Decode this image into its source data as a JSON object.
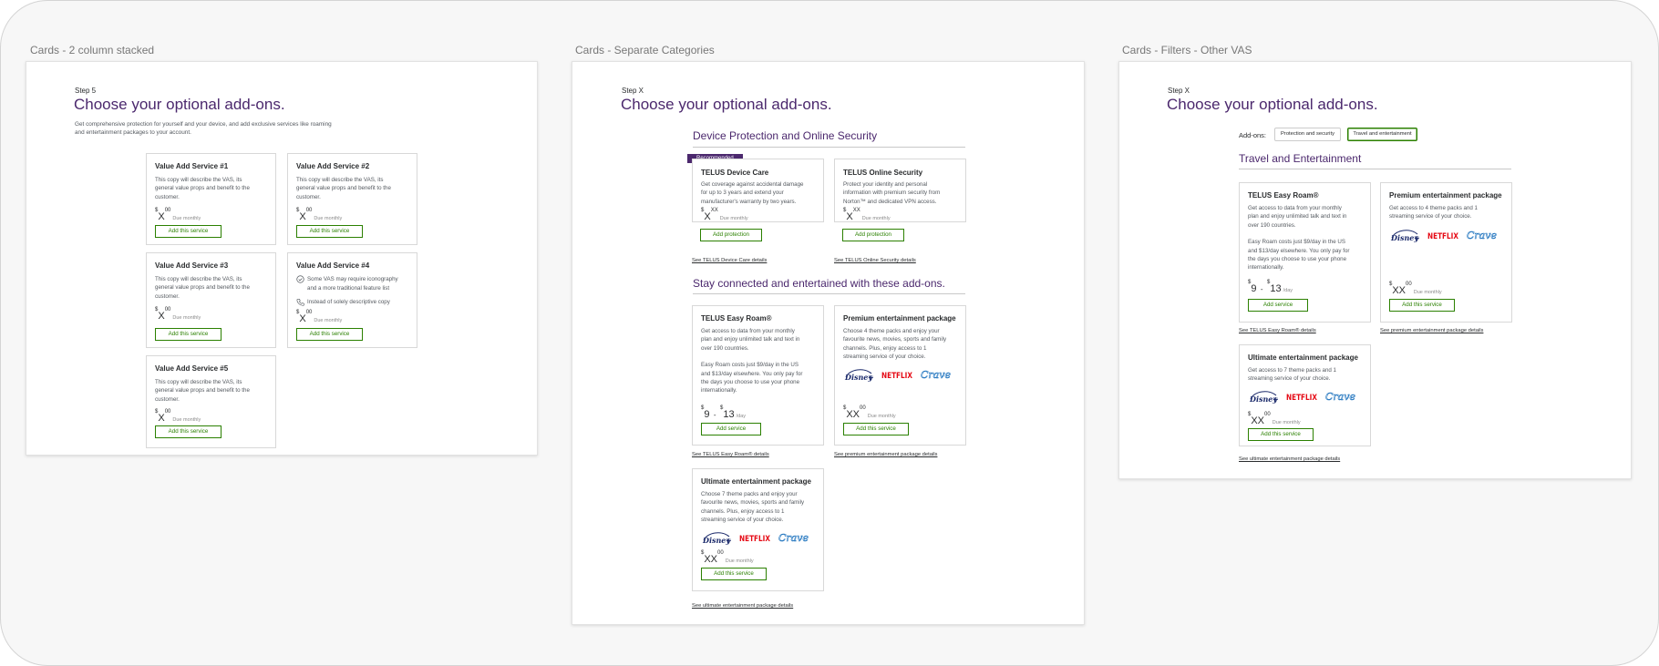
{
  "frames": [
    {
      "label": "Cards - 2 column stacked"
    },
    {
      "label": "Cards - Separate Categories"
    },
    {
      "label": "Cards - Filters - Other VAS"
    }
  ],
  "colors": {
    "brand_purple": "#4b286d",
    "accent_green": "#2b8000"
  },
  "logos": [
    "disney-plus-logo",
    "netflix-logo",
    "crave-logo"
  ],
  "f1": {
    "step": "Step 5",
    "title": "Choose your optional add-ons.",
    "intro1": "Get comprehensive protection for yourself and your device, and add exclusive services like roaming",
    "intro2": "and entertainment packages to your account.",
    "cards": [
      {
        "title": "Value Add Service #1",
        "d1": "This copy will describe the VAS, its",
        "d2": "general value props and benefit to the",
        "d3": "customer.",
        "price": "X",
        "cents": "00",
        "due": "Due monthly",
        "button": "Add this service"
      },
      {
        "title": "Value Add Service #2",
        "d1": "This copy will describe the VAS, its",
        "d2": "general value props and benefit to the",
        "d3": "customer.",
        "price": "X",
        "cents": "00",
        "due": "Due monthly",
        "button": "Add this service"
      },
      {
        "title": "Value Add Service #3",
        "d1": "This copy will describe the VAS, its",
        "d2": "general value props and benefit to the",
        "d3": "customer.",
        "price": "X",
        "cents": "00",
        "due": "Due monthly",
        "button": "Add this service"
      },
      {
        "title": "Value Add Service #4",
        "f1": "Some VAS may require iconography",
        "f1b": "and a more traditional feature list",
        "f2": "Instead of solely descriptive copy",
        "price": "X",
        "cents": "00",
        "due": "Due monthly",
        "button": "Add this service"
      },
      {
        "title": "Value Add Service #5",
        "d1": "This copy will describe the VAS, its",
        "d2": "general value props and benefit to the",
        "d3": "customer.",
        "price": "X",
        "cents": "00",
        "due": "Due monthly",
        "button": "Add this service"
      }
    ]
  },
  "f2": {
    "step": "Step X",
    "title": "Choose your optional add-ons.",
    "section1": "Device Protection and Online Security",
    "ribbon": "Recommended",
    "care": {
      "title": "TELUS Device Care",
      "d1": "Get coverage against accidental damage",
      "d2": "for up to 3 years and extend your",
      "d3": "manufacturer's warranty by two years.",
      "price": "X",
      "cents": "XX",
      "due": "Due monthly",
      "button": "Add protection",
      "link": "See TELUS Device Care details"
    },
    "security": {
      "title": "TELUS Online Security",
      "d1": "Protect your identity and personal",
      "d2": "information with premium security from",
      "d3": "Norton™ and dedicated VPN access.",
      "price": "X",
      "cents": "XX",
      "due": "Due monthly",
      "button": "Add protection",
      "link": "See TELUS Online Security details"
    },
    "section2": "Stay connected and entertained with these add-ons.",
    "roam": {
      "title": "TELUS Easy Roam®",
      "d1": "Get access to data from your monthly",
      "d2": "plan and enjoy unlimited talk and text in",
      "d3": "over 190 countries.",
      "d4": "Easy Roam costs just $9/day in the US",
      "d5": "and $13/day elsewhere. You only pay for",
      "d6": "the days you choose to use your phone",
      "d7": "internationally.",
      "p1": "9",
      "p2": "13",
      "dash": "-",
      "per": "/day",
      "button": "Add service",
      "link": "See TELUS Easy Roam® details"
    },
    "premium": {
      "title": "Premium entertainment package",
      "d1": "Choose 4 theme packs and enjoy your",
      "d2": "favourite news, movies, sports and family",
      "d3": "channels. Plus, enjoy access to 1",
      "d4": "streaming service of your choice.",
      "price": "XX",
      "cents": "00",
      "due": "Due monthly",
      "button": "Add this service",
      "link": "See premium entertainment package details"
    },
    "ultimate": {
      "title": "Ultimate entertainment package",
      "d1": "Choose 7 theme packs and enjoy your",
      "d2": "favourite news, movies, sports and family",
      "d3": "channels. Plus, enjoy access to 1",
      "d4": "streaming service of your choice.",
      "price": "XX",
      "cents": "00",
      "due": "Due monthly",
      "button": "Add this service",
      "link": "See ultimate entertainment package details"
    }
  },
  "f3": {
    "step": "Step X",
    "title": "Choose your optional add-ons.",
    "filter_label": "Add-ons:",
    "filters": [
      "Protection and security",
      "Travel and entertainment"
    ],
    "section": "Travel and Entertainment",
    "roam": {
      "title": "TELUS Easy Roam®",
      "d1": "Get access to data from your monthly",
      "d2": "plan and enjoy unlimited talk and text in",
      "d3": "over 190 countries.",
      "d4": "Easy Roam costs just $9/day in the US",
      "d5": "and $13/day elsewhere. You only pay for",
      "d6": "the days you choose to use your phone",
      "d7": "internationally.",
      "p1": "9",
      "p2": "13",
      "dash": "-",
      "per": "/day",
      "button": "Add service",
      "link": "See TELUS Easy Roam® details"
    },
    "premium": {
      "title": "Premium entertainment package",
      "d1": "Get access to 4 theme packs and 1",
      "d2": "streaming service of your choice.",
      "price": "XX",
      "cents": "00",
      "due": "Due monthly",
      "button": "Add this service",
      "link": "See premium entertainment package details"
    },
    "ultimate": {
      "title": "Ultimate entertainment package",
      "d1": "Get access to 7 theme packs and 1",
      "d2": "streaming service of your choice.",
      "price": "XX",
      "cents": "00",
      "due": "Due monthly",
      "button": "Add this service",
      "link": "See ultimate entertainment package details"
    }
  }
}
